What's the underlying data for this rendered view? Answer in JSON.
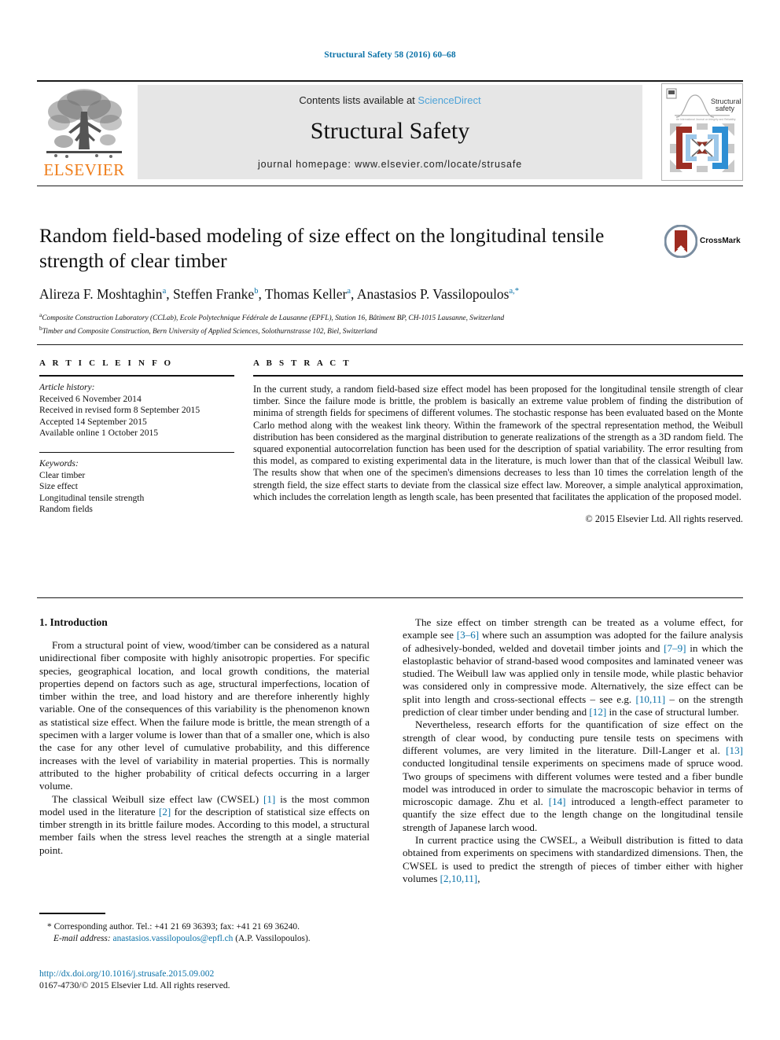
{
  "running_head": "Structural Safety 58 (2016) 60–68",
  "masthead": {
    "publisher_word": "ELSEVIER",
    "publisher_icon": "elsevier-tree-logo",
    "contents_prefix": "Contents lists available at ",
    "contents_link": "ScienceDirect",
    "journal_name": "Structural Safety",
    "homepage": "journal homepage: www.elsevier.com/locate/strusafe",
    "cover_title_line1": "Structural",
    "cover_title_line2": "safety"
  },
  "title_block": {
    "title": "Random field-based modeling of size effect on the longitudinal tensile strength of clear timber",
    "authors": [
      {
        "name": "Alireza F. Moshtaghin",
        "sup": "a",
        "sep": ", "
      },
      {
        "name": "Steffen Franke",
        "sup": "b",
        "sep": ", "
      },
      {
        "name": "Thomas Keller",
        "sup": "a",
        "sep": ", "
      },
      {
        "name": "Anastasios P. Vassilopoulos",
        "sup": "a,*",
        "sep": ""
      }
    ],
    "affiliation_a_sup": "a",
    "affiliation_a": "Composite Construction Laboratory (CCLab), Ecole Polytechnique Fédérale de Lausanne (EPFL), Station 16, Bâtiment BP, CH-1015 Lausanne, Switzerland",
    "affiliation_b_sup": "b",
    "affiliation_b": "Timber and Composite Construction, Bern University of Applied Sciences, Solothurnstrasse 102, Biel, Switzerland",
    "crossmark_label": "CrossMark"
  },
  "article_info": {
    "heading": "A R T I C L E    I N F O",
    "history_label": "Article history:",
    "history": [
      "Received 6 November 2014",
      "Received in revised form 8 September 2015",
      "Accepted 14 September 2015",
      "Available online 1 October 2015"
    ],
    "keywords_label": "Keywords:",
    "keywords": [
      "Clear timber",
      "Size effect",
      "Longitudinal tensile strength",
      "Random fields"
    ]
  },
  "abstract": {
    "heading": "A B S T R A C T",
    "text": "In the current study, a random field-based size effect model has been proposed for the longitudinal tensile strength of clear timber. Since the failure mode is brittle, the problem is basically an extreme value problem of finding the distribution of minima of strength fields for specimens of different volumes. The stochastic response has been evaluated based on the Monte Carlo method along with the weakest link theory. Within the framework of the spectral representation method, the Weibull distribution has been considered as the marginal distribution to generate realizations of the strength as a 3D random field. The squared exponential autocorrelation function has been used for the description of spatial variability. The error resulting from this model, as compared to existing experimental data in the literature, is much lower than that of the classical Weibull law. The results show that when one of the specimen's dimensions decreases to less than 10 times the correlation length of the strength field, the size effect starts to deviate from the classical size effect law. Moreover, a simple analytical approximation, which includes the correlation length as length scale, has been presented that facilitates the application of the proposed model.",
    "copyright": "© 2015 Elsevier Ltd. All rights reserved."
  },
  "body": {
    "section_heading": "1. Introduction",
    "left_paragraphs": [
      "From a structural point of view, wood/timber can be considered as a natural unidirectional fiber composite with highly anisotropic properties. For specific species, geographical location, and local growth conditions, the material properties depend on factors such as age, structural imperfections, location of timber within the tree, and load history and are therefore inherently highly variable. One of the consequences of this variability is the phenomenon known as statistical size effect. When the failure mode is brittle, the mean strength of a specimen with a larger volume is lower than that of a smaller one, which is also the case for any other level of cumulative probability, and this difference increases with the level of variability in material properties. This is normally attributed to the higher probability of critical defects occurring in a larger volume."
    ],
    "left_paragraph_2_parts": [
      {
        "t": "The classical Weibull size effect law (CWSEL) "
      },
      {
        "t": "[1]",
        "ref": true
      },
      {
        "t": " is the most common model used in the literature "
      },
      {
        "t": "[2]",
        "ref": true
      },
      {
        "t": " for the description of statistical size effects on timber strength in its brittle failure modes. According to this model, a structural member fails when the stress level reaches the strength at a single material point."
      }
    ],
    "right_paragraph_1_parts": [
      {
        "t": "The size effect on timber strength can be treated as a volume effect, for example see "
      },
      {
        "t": "[3–6]",
        "ref": true
      },
      {
        "t": " where such an assumption was adopted for the failure analysis of adhesively-bonded, welded and dovetail timber joints and "
      },
      {
        "t": "[7–9]",
        "ref": true
      },
      {
        "t": " in which the elastoplastic behavior of strand-based wood composites and laminated veneer was studied. The Weibull law was applied only in tensile mode, while plastic behavior was considered only in compressive mode. Alternatively, the size effect can be split into length and cross-sectional effects – see e.g. "
      },
      {
        "t": "[10,11]",
        "ref": true
      },
      {
        "t": " – on the strength prediction of clear timber under bending and "
      },
      {
        "t": "[12]",
        "ref": true
      },
      {
        "t": " in the case of structural lumber."
      }
    ],
    "right_paragraph_2_parts": [
      {
        "t": "Nevertheless, research efforts for the quantification of size effect on the strength of clear wood, by conducting pure tensile tests on specimens with different volumes, are very limited in the literature. Dill-Langer et al. "
      },
      {
        "t": "[13]",
        "ref": true
      },
      {
        "t": " conducted longitudinal tensile experiments on specimens made of spruce wood. Two groups of specimens with different volumes were tested and a fiber bundle model was introduced in order to simulate the macroscopic behavior in terms of microscopic damage. Zhu et al. "
      },
      {
        "t": "[14]",
        "ref": true
      },
      {
        "t": " introduced a length-effect parameter to quantify the size effect due to the length change on the longitudinal tensile strength of Japanese larch wood."
      }
    ],
    "right_paragraph_3_parts": [
      {
        "t": "In current practice using the CWSEL, a Weibull distribution is fitted to data obtained from experiments on specimens with standardized dimensions. Then, the CWSEL is used to predict the strength of pieces of timber either with higher volumes "
      },
      {
        "t": "[2,10,11]",
        "ref": true
      },
      {
        "t": ","
      }
    ]
  },
  "footnotes": {
    "corresponding_marker": "*",
    "corresponding": "Corresponding author. Tel.: +41 21 69 36393; fax: +41 21 69 36240.",
    "email_label": "E-mail address:",
    "email": "anastasios.vassilopoulos@epfl.ch",
    "email_suffix": "(A.P. Vassilopoulos).",
    "doi": "http://dx.doi.org/10.1016/j.strusafe.2015.09.002",
    "issn_line": "0167-4730/© 2015 Elsevier Ltd. All rights reserved."
  },
  "colors": {
    "link_blue": "#0b72a8",
    "sciencedirect_blue": "#4ea3d8",
    "elsevier_orange": "#ef7d1a",
    "masthead_grey": "#e6e6e6",
    "crossmark_red": "#9e2b20",
    "crossmark_ring": "#7a8da0"
  }
}
